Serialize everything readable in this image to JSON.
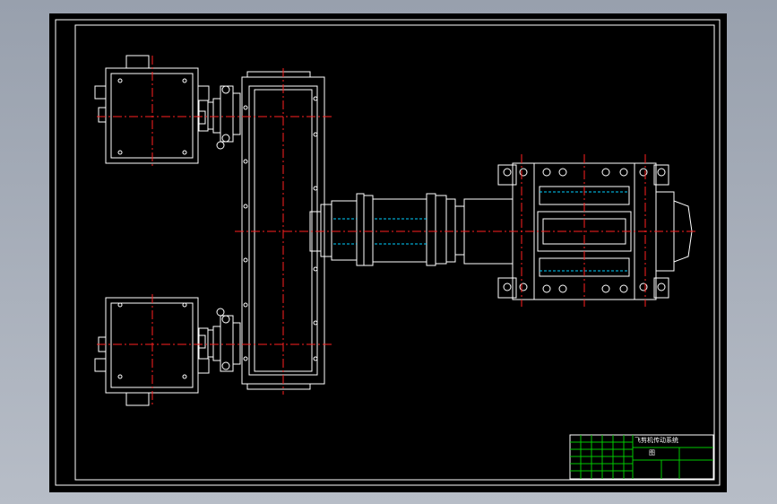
{
  "drawing": {
    "title_block": {
      "name_text": "飞剪机传动系统",
      "sub_text": "图"
    }
  },
  "colors": {
    "background": "#aab1bc",
    "sheet": "#000000",
    "lines": "#ffffff",
    "centerlines": "#ff2020",
    "hidden": "#00d0ff",
    "title_block_grid": "#00c800"
  }
}
